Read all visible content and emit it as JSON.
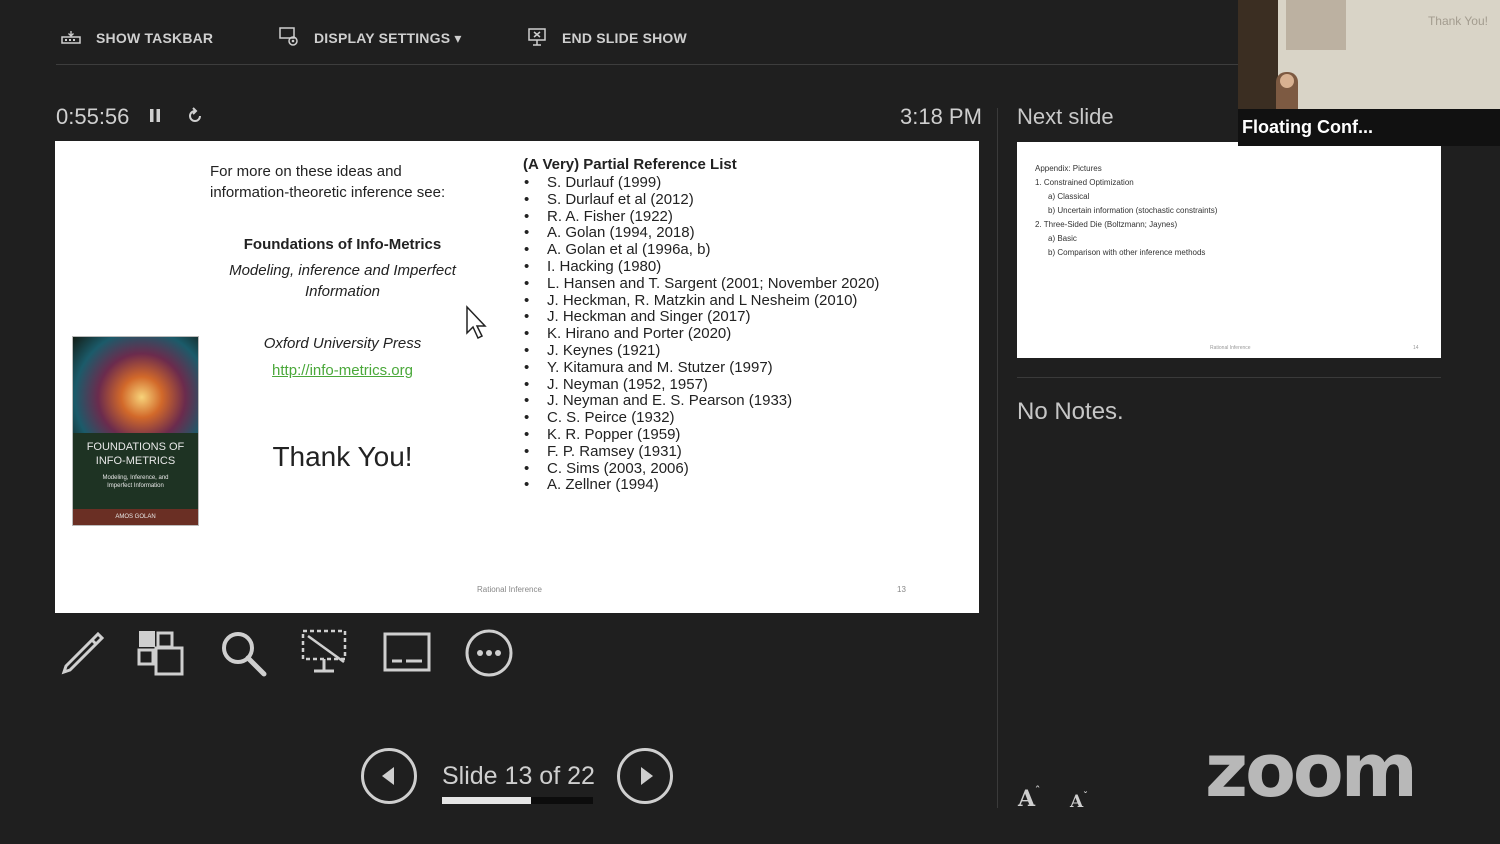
{
  "toolbar": {
    "show_taskbar": "SHOW TASKBAR",
    "display_settings": "DISPLAY SETTINGS ▾",
    "end_slide_show": "END SLIDE SHOW"
  },
  "timer": {
    "elapsed": "0:55:56",
    "clock": "3:18 PM"
  },
  "next_slide_label": "Next slide",
  "slide": {
    "intro_line1": "For more on these ideas and",
    "intro_line2": "information-theoretic inference see:",
    "book_title": "Foundations of Info-Metrics",
    "book_subtitle_line1": "Modeling, inference and Imperfect",
    "book_subtitle_line2": "Information",
    "publisher": "Oxford University Press",
    "link": "http://info-metrics.org",
    "thank_you": "Thank You!",
    "cover": {
      "title_line1": "FOUNDATIONS OF",
      "title_line2": "INFO-METRICS",
      "sub_line1": "Modeling, Inference, and",
      "sub_line2": "Imperfect Information",
      "author": "AMOS GOLAN"
    },
    "ref_heading": "(A Very) Partial Reference List",
    "references": [
      "S. Durlauf (1999)",
      "S. Durlauf et al (2012)",
      "R. A. Fisher (1922)",
      "A. Golan (1994, 2018)",
      "A. Golan et al (1996a, b)",
      "I. Hacking (1980)",
      "L. Hansen and T. Sargent (2001; November 2020)",
      "J. Heckman, R. Matzkin and L Nesheim (2010)",
      "J. Heckman and Singer (2017)",
      "K. Hirano and Porter (2020)",
      "J. Keynes (1921)",
      "Y. Kitamura and M. Stutzer (1997)",
      "J. Neyman (1952, 1957)",
      "J. Neyman and E. S. Pearson (1933)",
      "C. S. Peirce (1932)",
      "K. R. Popper (1959)",
      "F. P. Ramsey (1931)",
      "C. Sims (2003, 2006)",
      "A. Zellner (1994)"
    ],
    "footer_title": "Rational Inference",
    "footer_page": "13"
  },
  "next_slide": {
    "lines": [
      "Appendix: Pictures",
      "1.   Constrained Optimization",
      "a)   Classical",
      "b)   Uncertain information (stochastic constraints)",
      "2. Three-Sided Die (Boltzmann; Jaynes)",
      "a)   Basic",
      "b)   Comparison with other inference methods"
    ],
    "footer_title": "Rational Inference",
    "footer_page": "14"
  },
  "notes": "No Notes.",
  "navigation": {
    "counter": "Slide 13 of 22",
    "current": 13,
    "total": 22,
    "progress": 0.59
  },
  "video": {
    "label": "Floating Conf...",
    "background_text": "Thank You!"
  },
  "brand": "zoom",
  "font_buttons": {
    "increase": "A",
    "decrease": "A"
  },
  "colors": {
    "background": "#1f1f1f",
    "link": "#4aa83a",
    "text": "#cfcfcf"
  }
}
